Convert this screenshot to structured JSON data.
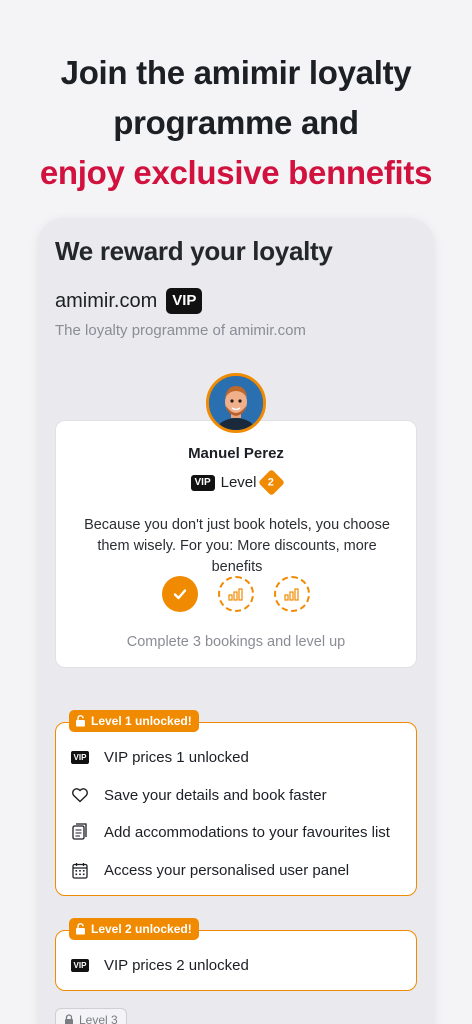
{
  "headline": {
    "line1": "Join the amimir loyalty",
    "line2": "programme and",
    "line3": "enjoy exclusive bennefits"
  },
  "screen": {
    "title": "We reward your loyalty",
    "brand": "amimir.com",
    "brand_badge": "VIP",
    "subtitle": "The loyalty programme of amimir.com"
  },
  "profile": {
    "name": "Manuel Perez",
    "vip_badge": "VIP",
    "level_label": "Level",
    "level_number": "2",
    "description": "Because you don't just book hotels, you choose them wisely. For you: More discounts, more benefits",
    "steps_completed": 1,
    "steps_total": 3,
    "footer": "Complete 3 bookings and level up"
  },
  "level1": {
    "tag": "Level 1 unlocked!",
    "benefits": [
      {
        "icon": "vip-icon",
        "text": "VIP prices 1 unlocked"
      },
      {
        "icon": "heart-icon",
        "text": "Save your details and book faster"
      },
      {
        "icon": "list-icon",
        "text": "Add accommodations to your favourites list"
      },
      {
        "icon": "calendar-icon",
        "text": "Access your personalised user panel"
      }
    ]
  },
  "level2": {
    "tag": "Level 2 unlocked!",
    "benefits": [
      {
        "icon": "vip-icon",
        "text": "VIP prices 2 unlocked"
      }
    ]
  },
  "level3": {
    "tag": "Level 3"
  },
  "colors": {
    "accent": "#f08a00",
    "headline_red": "#d1123f",
    "background": "#f4f4f6"
  }
}
